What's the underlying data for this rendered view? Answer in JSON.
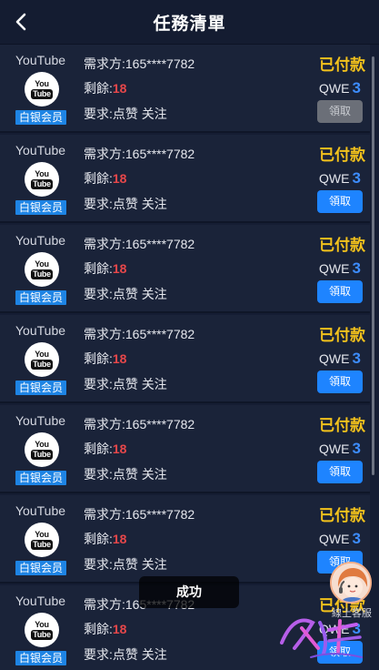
{
  "header": {
    "title": "任務清單"
  },
  "tasks": [
    {
      "platform": "YouTube",
      "logo_top": "You",
      "logo_bottom": "Tube",
      "member": "白银会员",
      "requester": "需求方:165****7782",
      "remain_label": "剩餘:",
      "remain_count": "18",
      "requirement": "要求:点赞 关注",
      "status": "已付款",
      "code_label": "QWE",
      "code_num": "3",
      "button": "領取"
    },
    {
      "platform": "YouTube",
      "logo_top": "You",
      "logo_bottom": "Tube",
      "member": "白银会员",
      "requester": "需求方:165****7782",
      "remain_label": "剩餘:",
      "remain_count": "18",
      "requirement": "要求:点赞 关注",
      "status": "已付款",
      "code_label": "QWE",
      "code_num": "3",
      "button": "領取"
    },
    {
      "platform": "YouTube",
      "logo_top": "You",
      "logo_bottom": "Tube",
      "member": "白银会员",
      "requester": "需求方:165****7782",
      "remain_label": "剩餘:",
      "remain_count": "18",
      "requirement": "要求:点赞 关注",
      "status": "已付款",
      "code_label": "QWE",
      "code_num": "3",
      "button": "領取"
    },
    {
      "platform": "YouTube",
      "logo_top": "You",
      "logo_bottom": "Tube",
      "member": "白银会员",
      "requester": "需求方:165****7782",
      "remain_label": "剩餘:",
      "remain_count": "18",
      "requirement": "要求:点赞 关注",
      "status": "已付款",
      "code_label": "QWE",
      "code_num": "3",
      "button": "領取"
    },
    {
      "platform": "YouTube",
      "logo_top": "You",
      "logo_bottom": "Tube",
      "member": "白银会员",
      "requester": "需求方:165****7782",
      "remain_label": "剩餘:",
      "remain_count": "18",
      "requirement": "要求:点赞 关注",
      "status": "已付款",
      "code_label": "QWE",
      "code_num": "3",
      "button": "領取"
    },
    {
      "platform": "YouTube",
      "logo_top": "You",
      "logo_bottom": "Tube",
      "member": "白银会员",
      "requester": "需求方:165****7782",
      "remain_label": "剩餘:",
      "remain_count": "18",
      "requirement": "要求:点赞 关注",
      "status": "已付款",
      "code_label": "QWE",
      "code_num": "3",
      "button": "領取"
    },
    {
      "platform": "YouTube",
      "logo_top": "You",
      "logo_bottom": "Tube",
      "member": "白银会员",
      "requester": "需求方:165****7782",
      "remain_label": "剩餘:",
      "remain_count": "18",
      "requirement": "要求:点赞 关注",
      "status": "已付款",
      "code_label": "QWE",
      "code_num": "3",
      "button": "領取"
    }
  ],
  "toast": "成功",
  "customer_service": {
    "label": "線上客服",
    "icon": "customer-service-avatar-icon"
  },
  "watermark": {
    "icon": "brand-watermark-logo"
  },
  "colors": {
    "background": "#151d33",
    "card": "#1a2339",
    "accent_blue": "#1e84ff",
    "paid_gold": "#f3c21c",
    "remain_red": "#e8474a",
    "disabled_gray": "#6b6f78"
  }
}
